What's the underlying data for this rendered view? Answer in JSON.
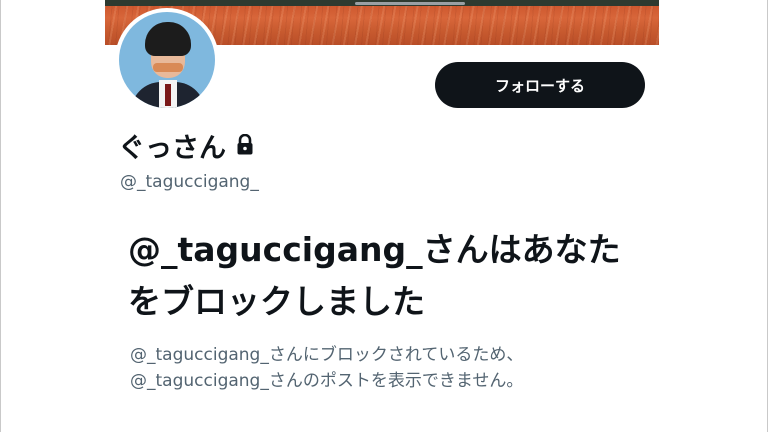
{
  "profile": {
    "display_name": "ぐっさん",
    "handle": "@_taguccigang_",
    "follow_label": "フォローする",
    "protected_icon": "lock-icon"
  },
  "blocked_notice": {
    "headline": "@_taguccigang_さんはあなたをブロックしました",
    "message": "@_taguccigang_さんにブロックされているため、@_taguccigang_さんのポストを表示できません。"
  },
  "colors": {
    "text_primary": "#0f1419",
    "text_secondary": "#536471",
    "button_bg": "#0f1419",
    "banner": "#c9532a",
    "avatar_bg": "#7fb8de"
  }
}
